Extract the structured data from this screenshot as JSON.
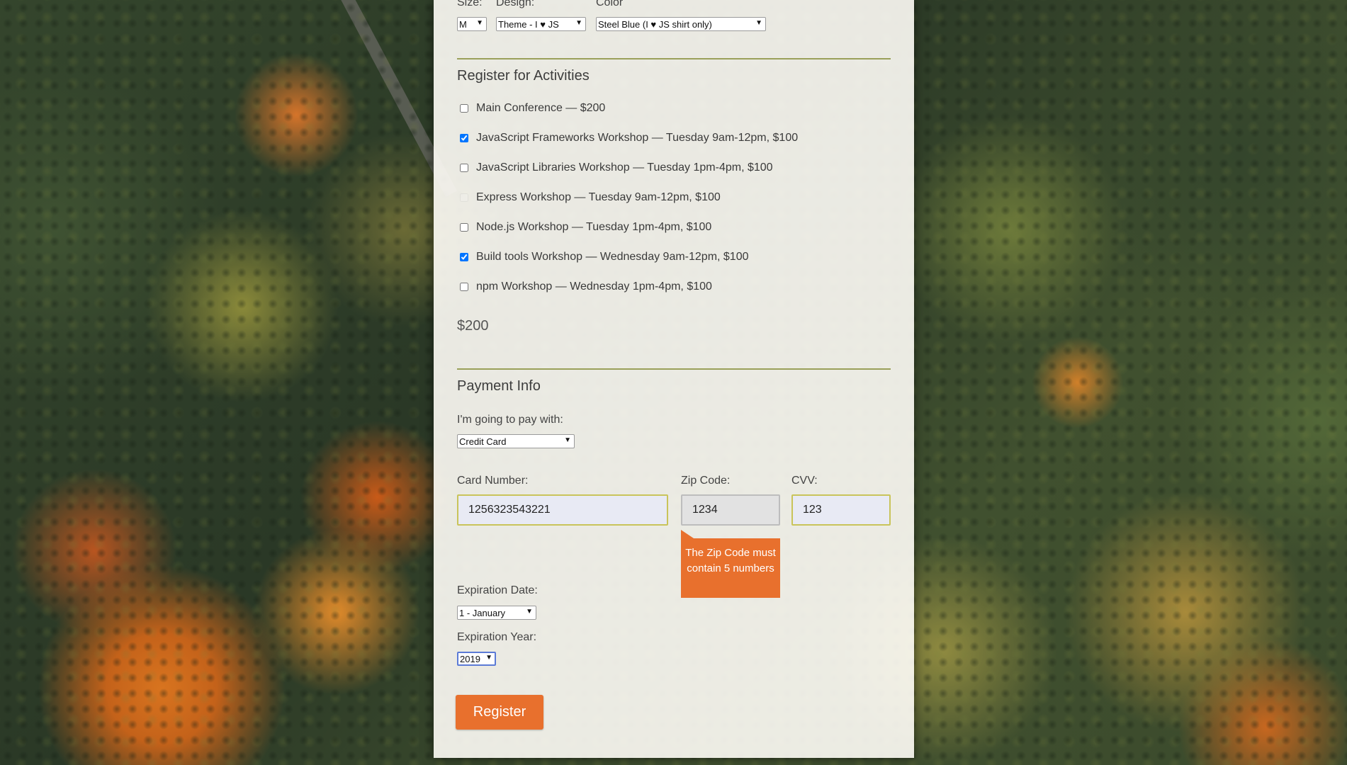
{
  "tshirt": {
    "size_label": "Size:",
    "design_label": "Design:",
    "color_label": "Color",
    "size_value": "M",
    "design_value": "Theme - I ♥ JS",
    "color_value": "Steel Blue (I ♥ JS shirt only)"
  },
  "activities": {
    "title": "Register for Activities",
    "items": [
      {
        "label": "Main Conference — $200",
        "checked": false,
        "disabled": false
      },
      {
        "label": "JavaScript Frameworks Workshop — Tuesday 9am-12pm, $100",
        "checked": true,
        "disabled": false
      },
      {
        "label": "JavaScript Libraries Workshop — Tuesday 1pm-4pm, $100",
        "checked": false,
        "disabled": false
      },
      {
        "label": "Express Workshop — Tuesday 9am-12pm, $100",
        "checked": false,
        "disabled": true
      },
      {
        "label": "Node.js Workshop — Tuesday 1pm-4pm, $100",
        "checked": false,
        "disabled": false
      },
      {
        "label": "Build tools Workshop — Wednesday 9am-12pm, $100",
        "checked": true,
        "disabled": false
      },
      {
        "label": "npm Workshop — Wednesday 1pm-4pm, $100",
        "checked": false,
        "disabled": false
      }
    ],
    "total": "$200"
  },
  "payment": {
    "title": "Payment Info",
    "pay_with_label": "I'm going to pay with:",
    "pay_with_value": "Credit Card",
    "card_number_label": "Card Number:",
    "card_number_value": "1256323543221",
    "zip_label": "Zip Code:",
    "zip_value": "1234",
    "cvv_label": "CVV:",
    "cvv_value": "123",
    "zip_error": "The Zip Code must contain 5 numbers",
    "exp_date_label": "Expiration Date:",
    "exp_date_value": "1 - January",
    "exp_year_label": "Expiration Year:",
    "exp_year_value": "2019"
  },
  "register_button": "Register",
  "colors": {
    "accent": "#e8702d",
    "rule": "#9aa05a",
    "field_border": "#c9c45a"
  }
}
